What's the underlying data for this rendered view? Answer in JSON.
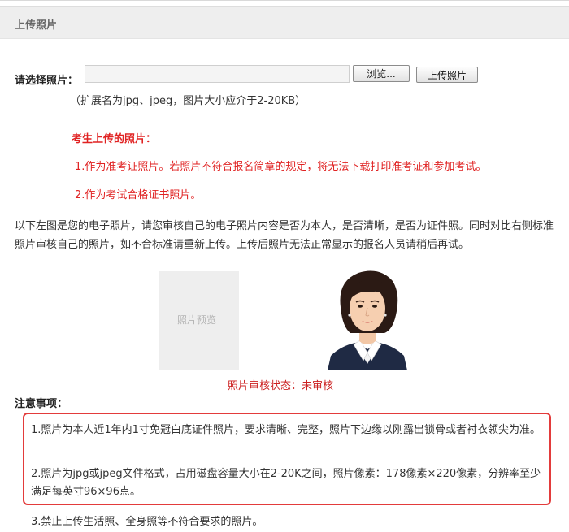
{
  "header": {
    "title": "上传照片"
  },
  "upload": {
    "label": "请选择照片：",
    "file_value": "",
    "browse_label": "浏览...",
    "upload_label": "上传照片",
    "hint": "（扩展名为jpg、jpeg，图片大小应介于2-20KB）"
  },
  "notice": {
    "title": "考生上传的照片：",
    "items": [
      "1.作为准考证照片。若照片不符合报名简章的规定，将无法下载打印准考证和参加考试。",
      "2.作为考试合格证书照片。"
    ]
  },
  "description": "以下左图是您的电子照片，请您审核自己的电子照片内容是否为本人，是否清晰，是否为证件照。同时对比右侧标准照片审核自己的照片，如不合标准请重新上传。上传后照片无法正常显示的报名人员请稍后再试。",
  "preview": {
    "placeholder": "照片预览"
  },
  "status": "照片审核状态：未审核",
  "notes": {
    "title": "注意事项：",
    "items": [
      "1.照片为本人近1年内1寸免冠白底证件照片，要求清晰、完整，照片下边缘以刚露出锁骨或者衬衣领尖为准。",
      "2.照片为jpg或jpeg文件格式，占用磁盘容量大小在2-20K之间，照片像素：178像素×220像素，分辨率至少满足每英寸96×96点。",
      "3.禁止上传生活照、全身照等不符合要求的照片。"
    ]
  },
  "colors": {
    "notice_red": "#e02222",
    "box_border": "#e33b3b",
    "header_bg": "#eeeeee"
  }
}
